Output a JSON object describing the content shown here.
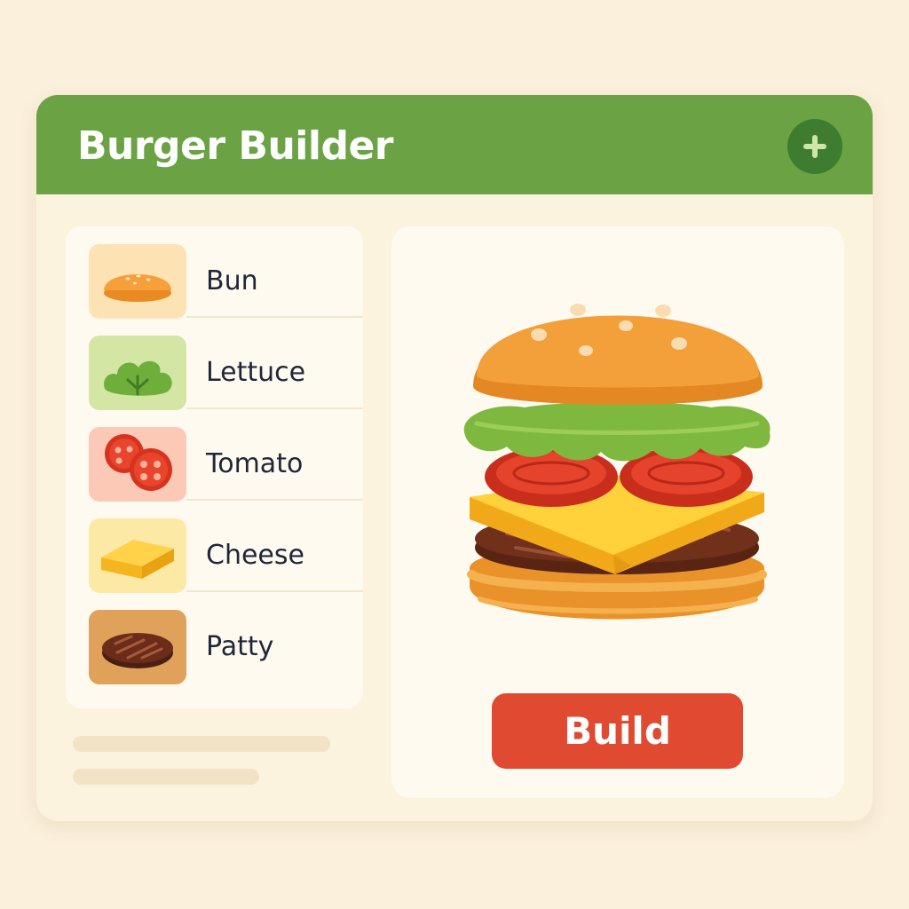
{
  "app": {
    "title": "Burger Builder",
    "add_button_icon": "plus-icon"
  },
  "ingredients": [
    {
      "label": "Bun",
      "icon": "bun-icon",
      "thumb_color": "#fde3b3"
    },
    {
      "label": "Lettuce",
      "icon": "lettuce-icon",
      "thumb_color": "#d3e6a4"
    },
    {
      "label": "Tomato",
      "icon": "tomato-icon",
      "thumb_color": "#fbc9b5"
    },
    {
      "label": "Cheese",
      "icon": "cheese-icon",
      "thumb_color": "#fde9a6"
    },
    {
      "label": "Patty",
      "icon": "patty-icon",
      "thumb_color": "#e0a15a"
    }
  ],
  "preview": {
    "layers": [
      "bun-top",
      "lettuce",
      "tomato",
      "cheese",
      "patty",
      "bun-bottom"
    ],
    "build_label": "Build"
  },
  "colors": {
    "header": "#6aa244",
    "accent_button": "#e04a31",
    "background": "#fbf0dc"
  }
}
